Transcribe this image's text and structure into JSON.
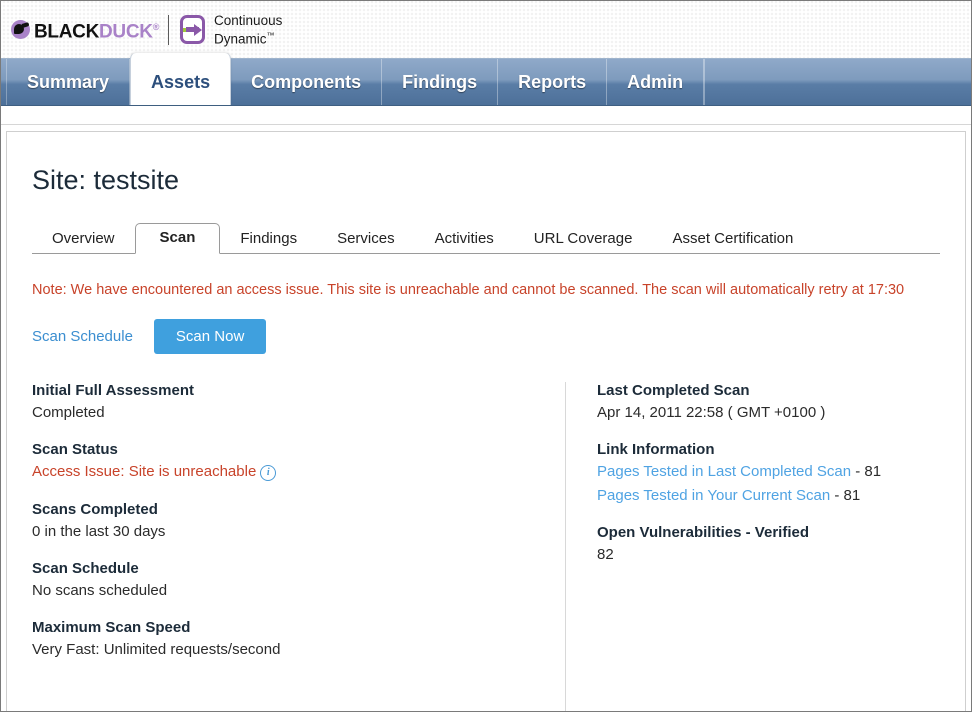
{
  "brand": {
    "name_black": "BLACK",
    "name_purple": "DUCK",
    "registered": "®",
    "product_line1": "Continuous",
    "product_line2": "Dynamic",
    "trademark": "™",
    "accent_purple": "#a982c8",
    "accent_green": "#9ec93a"
  },
  "nav": {
    "tabs": [
      {
        "label": "Summary",
        "active": false
      },
      {
        "label": "Assets",
        "active": true
      },
      {
        "label": "Components",
        "active": false
      },
      {
        "label": "Findings",
        "active": false
      },
      {
        "label": "Reports",
        "active": false
      },
      {
        "label": "Admin",
        "active": false
      }
    ]
  },
  "page": {
    "title": "Site: testsite"
  },
  "subtabs": [
    {
      "label": "Overview",
      "active": false
    },
    {
      "label": "Scan",
      "active": true
    },
    {
      "label": "Findings",
      "active": false
    },
    {
      "label": "Services",
      "active": false
    },
    {
      "label": "Activities",
      "active": false
    },
    {
      "label": "URL Coverage",
      "active": false
    },
    {
      "label": "Asset Certification",
      "active": false
    }
  ],
  "note": {
    "text": "Note: We have encountered an access issue. This site is unreachable and cannot be scanned. The scan will automatically retry at 17:30",
    "color": "#c8432a"
  },
  "actions": {
    "scan_schedule_link": "Scan Schedule",
    "scan_now_button": "Scan Now",
    "button_color": "#3fa0de"
  },
  "left_column": {
    "initial_full_assessment": {
      "label": "Initial Full Assessment",
      "value": "Completed"
    },
    "scan_status": {
      "label": "Scan Status",
      "value": "Access Issue: Site is unreachable",
      "value_color": "#c8432a",
      "info_icon": "info-icon",
      "info_glyph": "i"
    },
    "scans_completed": {
      "label": "Scans Completed",
      "value": "0 in the last 30 days"
    },
    "scan_schedule": {
      "label": "Scan Schedule",
      "value": "No scans scheduled"
    },
    "maximum_scan_speed": {
      "label": "Maximum Scan Speed",
      "value": "Very Fast: Unlimited requests/second"
    }
  },
  "right_column": {
    "last_completed_scan": {
      "label": "Last Completed Scan",
      "value": "Apr 14, 2011 22:58 ( GMT +0100 )"
    },
    "link_information": {
      "label": "Link Information",
      "links": [
        {
          "text": "Pages Tested in Last Completed Scan",
          "count": "- 81"
        },
        {
          "text": "Pages Tested in Your Current Scan",
          "count": "- 81"
        }
      ],
      "link_color": "#4fa3e3"
    },
    "open_vulnerabilities": {
      "label": "Open Vulnerabilities - Verified",
      "value": "82"
    }
  }
}
